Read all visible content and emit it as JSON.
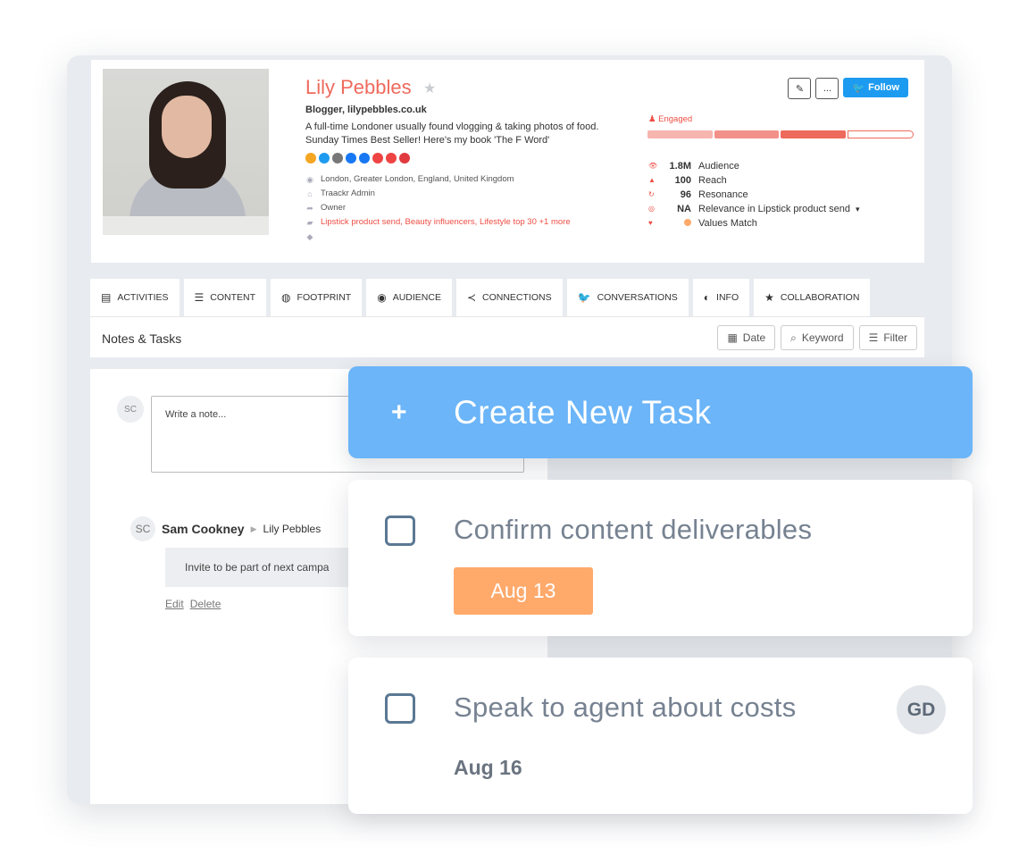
{
  "profile": {
    "name": "Lily Pebbles",
    "subtitle": "Blogger, lilypebbles.co.uk",
    "bio_line1": "A full-time Londoner usually found vlogging & taking photos of food.",
    "bio_line2": "Sunday Times Best Seller! Here's my book 'The F Word'",
    "location": "London, Greater London, England, United Kingdom",
    "admin": "Traackr Admin",
    "owner": "Owner",
    "lists": "Lipstick product send, Beauty influencers, Lifestyle top 30 +1 more",
    "follow_label": "Follow",
    "more_label": "...",
    "engaged_label": "Engaged",
    "social_colors": [
      "#f5a623",
      "#1d9bf0",
      "#777777",
      "#1877f2",
      "#1877f2",
      "#ee4444",
      "#ee4444",
      "#e03a3e"
    ]
  },
  "stats": [
    {
      "value": "1.8M",
      "label": "Audience"
    },
    {
      "value": "100",
      "label": "Reach"
    },
    {
      "value": "96",
      "label": "Resonance"
    },
    {
      "value": "NA",
      "label": "Relevance in Lipstick product send"
    },
    {
      "value": "",
      "label": "Values Match"
    }
  ],
  "engagement_bar": {
    "colors": [
      "#f6b5ae",
      "#f29189",
      "#ee6a5c",
      "#ffffff"
    ],
    "border": "#ee6a5c"
  },
  "tabs": [
    {
      "label": "ACTIVITIES",
      "icon": "activities-icon"
    },
    {
      "label": "CONTENT",
      "icon": "content-icon"
    },
    {
      "label": "FOOTPRINT",
      "icon": "globe-icon"
    },
    {
      "label": "AUDIENCE",
      "icon": "eye-icon"
    },
    {
      "label": "CONNECTIONS",
      "icon": "share-icon"
    },
    {
      "label": "CONVERSATIONS",
      "icon": "twitter-icon"
    },
    {
      "label": "INFO",
      "icon": "user-icon"
    },
    {
      "label": "COLLABORATION",
      "icon": "star-icon"
    }
  ],
  "notes": {
    "title": "Notes & Tasks",
    "filter_date": "Date",
    "filter_keyword": "Keyword",
    "filter_filter": "Filter",
    "avatar_initials": "SC",
    "input_placeholder": "Write a note...",
    "author": "Sam Cookney",
    "recipient": "Lily Pebbles",
    "note_text": "Invite to be part of next campa",
    "edit_label": "Edit",
    "delete_label": "Delete"
  },
  "create_task": {
    "label": "Create New Task",
    "plus": "+"
  },
  "tasks": [
    {
      "title": "Confirm content deliverables",
      "date": "Aug 13",
      "badge_color": "#ffa96b"
    },
    {
      "title": "Speak to agent about costs",
      "date": "Aug 16",
      "assignee": "GD"
    }
  ]
}
